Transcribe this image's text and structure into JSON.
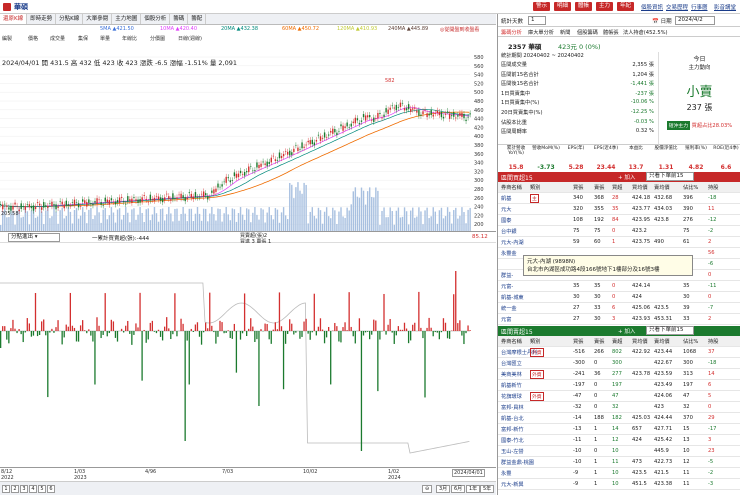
{
  "window": {
    "app_name": "華碩",
    "top_buttons": [
      "警示",
      "明細",
      "體帳",
      "主力",
      "年紀"
    ],
    "top_links": [
      "個股資訊",
      "交易歷程",
      "行事曆",
      "影音講堂"
    ]
  },
  "tabs": [
    "還原K線",
    "即時走勢",
    "分點K線",
    "大單參閱",
    "主力地圖",
    "個股分析",
    "籌碼",
    "籌配"
  ],
  "legend": [
    {
      "t": "5MA ▲421.50",
      "c": "#3a6fd8"
    },
    {
      "t": "10MA ▲420.40",
      "c": "#e040fb"
    },
    {
      "t": "20MA ▲432.38",
      "c": "#00897b"
    },
    {
      "t": "60MA ▲450.72",
      "c": "#ef6c00"
    },
    {
      "t": "120MA ▲410.93",
      "c": "#c0ca33"
    },
    {
      "t": "240MA ▲445.89",
      "c": "#5d4037"
    },
    {
      "t": "◎從開盤到收盤看",
      "c": "#c62828"
    }
  ],
  "toolbar2": [
    "編製",
    "價格",
    "成交量",
    "集保",
    "單量",
    "年線比",
    "分價圖",
    "日線(週線)"
  ],
  "price_info": {
    "line1": "2024/04/01  開 431.5  高 432  低 423  收 423  漲跌 -6.5  漲幅 -1.51%  量 2,091"
  },
  "main_chart": {
    "y_ticks": [
      "580",
      "560",
      "540",
      "520",
      "500",
      "480",
      "460",
      "440",
      "420",
      "400",
      "380",
      "360",
      "340",
      "320",
      "300",
      "280",
      "260",
      "240",
      "220",
      "200"
    ],
    "high_label": "582",
    "low_label": "205.58"
  },
  "sub_header": {
    "select": "分點進出",
    "title1": "一累計買賣超(張):-444",
    "title2": "買賣超(張)2",
    "title3": "買進 3  賣張 1",
    "right_val": "85.12"
  },
  "x_axis": [
    "8/12",
    "1/03",
    "4/96",
    "7/03",
    "10/02",
    "1/02",
    "2024/04/01"
  ],
  "x_axis_years": [
    "2022",
    "2023",
    "",
    "",
    "",
    "2024",
    ""
  ],
  "bottom": {
    "pages": [
      "1",
      "2",
      "3",
      "4",
      "5",
      "6"
    ],
    "periods": [
      "3月",
      "6月",
      "1年",
      "5年"
    ]
  },
  "right": {
    "select_label": "統計天數",
    "select_val": "1",
    "date_label": "日期",
    "date_val": "2024/4/2",
    "subtabs": [
      "籌碼分析",
      "庫大單分析",
      "新聞",
      "個股籌碼",
      "體帳張",
      "法人持倉(452.5%)"
    ],
    "stock": "2357 華碩",
    "stock_price": "423元 0 (0%)",
    "stats_period": "統計期間  20240402 ~ 20240402",
    "stats": [
      {
        "k": "區間成交量",
        "v": "2,355 張"
      },
      {
        "k": "區間前15名合計",
        "v": "1,204 張"
      },
      {
        "k": "區間後15名合計",
        "v": "-1,441 張"
      },
      {
        "k": "1日買賣集中",
        "v": "-237 張"
      },
      {
        "k": "1日買賣集中(%)",
        "v": "-10.06 %"
      },
      {
        "k": "20日買賣集中(%)",
        "v": "-12.25 %"
      },
      {
        "k": "佔股本比重",
        "v": "-0.03 %"
      },
      {
        "k": "區間周轉率",
        "v": "0.32 %"
      }
    ],
    "today": {
      "title": "今日",
      "sub": "主力動向",
      "verdict": "小賣",
      "amount": "237 張",
      "short_label": "短沖主力",
      "short_val": "買超占比28.03%"
    },
    "metrics_head": [
      "累計營收YoY(%)",
      "營收MoM(%)",
      "EPS(年)",
      "EPS(近4季)",
      "本益比",
      "股價淨值比",
      "殖利率(%)",
      "ROE(近4季)"
    ],
    "metrics": [
      "15.8",
      "-3.73",
      "5.28",
      "23.44",
      "13.7",
      "1.31",
      "4.82",
      "6.6"
    ],
    "buy_table": {
      "title": "區間買超15",
      "btn": "加入",
      "view": "只看下單前15",
      "cols": [
        "券商名稱",
        "類別",
        "買張",
        "賣張",
        "買超",
        "買均價",
        "賣均價",
        "佔比%",
        "持股"
      ],
      "rows": [
        [
          "凱基",
          "主",
          "340",
          "368",
          "28",
          "424.18",
          "432.68",
          "396",
          "-18"
        ],
        [
          "元大",
          "",
          "320",
          "355",
          "35",
          "423.77",
          "434.03",
          "390",
          "11"
        ],
        [
          "國泰",
          "",
          "108",
          "192",
          "84",
          "423.95",
          "423.8",
          "276",
          "-12"
        ],
        [
          "台中銀",
          "",
          "75",
          "75",
          "0",
          "423.2",
          "",
          "75",
          "-2"
        ],
        [
          "元大-內湖",
          "",
          "59",
          "60",
          "1",
          "423.75",
          "490",
          "61",
          "2"
        ],
        [
          "永豐金",
          "",
          "",
          "",
          "",
          "",
          "",
          "",
          "56"
        ],
        [
          "",
          "",
          "",
          "",
          "",
          "",
          "",
          "",
          "-6"
        ],
        [
          "群益-",
          "",
          "",
          "",
          "",
          "",
          "",
          "",
          "0"
        ],
        [
          "元富-",
          "",
          "35",
          "35",
          "0",
          "424.14",
          "",
          "35",
          "-11"
        ],
        [
          "凱基-城東",
          "",
          "30",
          "30",
          "0",
          "424",
          "",
          "30",
          "0"
        ],
        [
          "統一金",
          "",
          "27",
          "33",
          "6",
          "425.06",
          "423.5",
          "39",
          "-7"
        ],
        [
          "元富",
          "",
          "27",
          "30",
          "3",
          "423.93",
          "453.31",
          "33",
          "2"
        ]
      ]
    },
    "sell_table": {
      "title": "區間賣超15",
      "btn": "加入",
      "view": "只看下單前15",
      "cols": [
        "券商名稱",
        "類別",
        "買張",
        "賣張",
        "賣超",
        "買均價",
        "賣均價",
        "佔比%",
        "持股"
      ],
      "rows": [
        [
          "台灣摩根士丹利",
          "外資",
          "-516",
          "266",
          "802",
          "422.92",
          "423.44",
          "1068",
          "37"
        ],
        [
          "台灣匯立",
          "",
          "-300",
          "0",
          "300",
          "",
          "422.67",
          "300",
          "-18"
        ],
        [
          "美商美林",
          "外資",
          "-241",
          "36",
          "277",
          "423.78",
          "423.59",
          "313",
          "14"
        ],
        [
          "凱基新竹",
          "",
          "-197",
          "0",
          "197",
          "",
          "423.49",
          "197",
          "6"
        ],
        [
          "花旗環球",
          "外資",
          "-47",
          "0",
          "47",
          "",
          "424.06",
          "47",
          "5"
        ],
        [
          "富邦-員林",
          "",
          "-32",
          "0",
          "32",
          "",
          "423",
          "32",
          "0"
        ],
        [
          "凱基-台北",
          "",
          "-14",
          "188",
          "182",
          "425.03",
          "424.44",
          "370",
          "29"
        ],
        [
          "富邦-新竹",
          "",
          "-13",
          "1",
          "14",
          "657",
          "427.71",
          "15",
          "-17"
        ],
        [
          "國泰-竹北",
          "",
          "-11",
          "1",
          "12",
          "424",
          "425.42",
          "13",
          "3"
        ],
        [
          "玉山-左營",
          "",
          "-10",
          "0",
          "10",
          "",
          "445.9",
          "10",
          "23"
        ],
        [
          "群益金鼎-桃園",
          "",
          "-10",
          "1",
          "11",
          "473",
          "422.73",
          "12",
          "-5"
        ],
        [
          "永豐",
          "",
          "-9",
          "1",
          "10",
          "423.5",
          "421.5",
          "11",
          "-2"
        ],
        [
          "元大-新興",
          "",
          "-9",
          "1",
          "10",
          "451.5",
          "423.38",
          "11",
          "-3"
        ]
      ]
    },
    "tooltip": [
      "元大-內湖 (9898N)",
      "台北市內湖區成功路4段166號地下1樓部分及16號3樓"
    ]
  }
}
